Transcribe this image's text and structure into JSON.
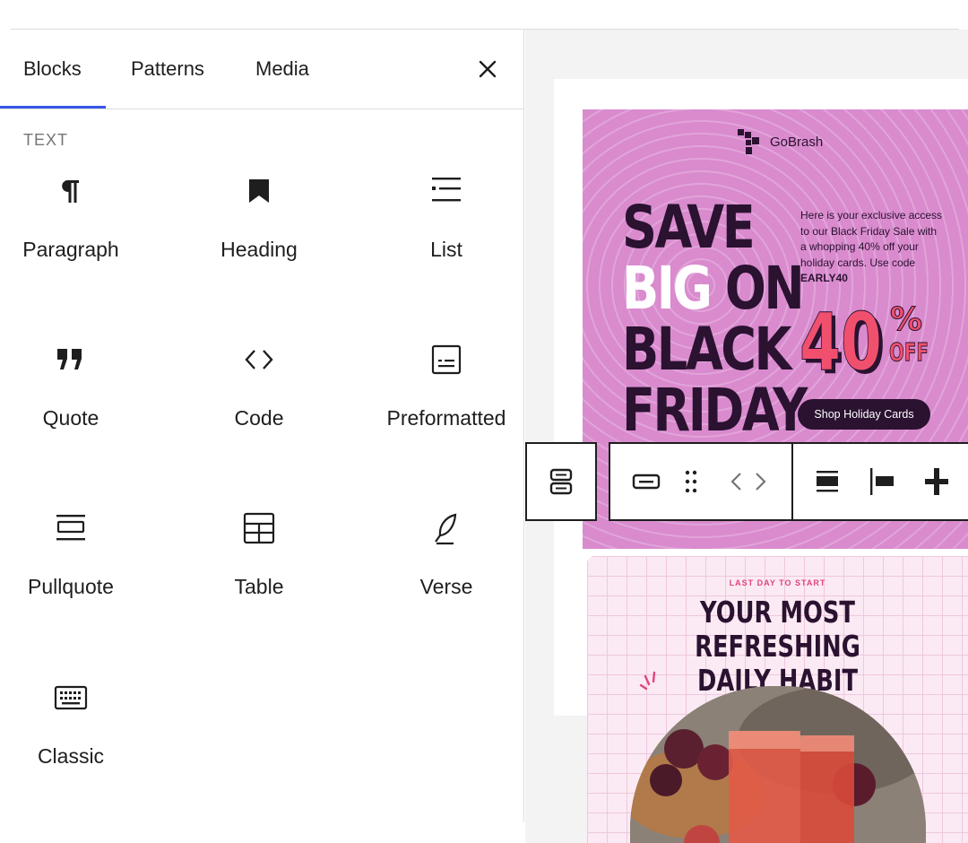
{
  "inserter": {
    "tabs": [
      "Blocks",
      "Patterns",
      "Media"
    ],
    "active_tab": "Blocks",
    "close_icon": "close-icon",
    "category": "TEXT",
    "blocks": [
      {
        "label": "Paragraph",
        "icon": "paragraph-icon"
      },
      {
        "label": "Heading",
        "icon": "heading-icon"
      },
      {
        "label": "List",
        "icon": "list-icon"
      },
      {
        "label": "Quote",
        "icon": "quote-icon"
      },
      {
        "label": "Code",
        "icon": "code-icon"
      },
      {
        "label": "Preformatted",
        "icon": "preformatted-icon"
      },
      {
        "label": "Pullquote",
        "icon": "pullquote-icon"
      },
      {
        "label": "Table",
        "icon": "table-icon"
      },
      {
        "label": "Verse",
        "icon": "verse-icon"
      },
      {
        "label": "Classic",
        "icon": "classic-icon"
      }
    ]
  },
  "canvas": {
    "card1": {
      "brand": "GoBrash",
      "headline": [
        "SAVE",
        "BIG",
        "ON",
        "BLACK",
        "FRIDAY"
      ],
      "copy": "Here is your exclusive access to our Black Friday Sale with a whopping 40% off your holiday cards. Use code",
      "code": "EARLY40",
      "percent": "40",
      "percent_sign": "%",
      "off": "OFF",
      "button": "Shop Holiday Cards"
    },
    "card2": {
      "eyebrow": "LAST DAY TO START",
      "headline_line1": "YOUR MOST REFRESHING",
      "headline_line2": "DAILY HABIT"
    }
  },
  "toolbar": {
    "buttons": [
      "parent-block-icon",
      "block-type-icon",
      "drag-handle-icon",
      "move-left-icon",
      "move-right-icon",
      "align-wide-icon",
      "align-left-icon",
      "add-icon"
    ]
  },
  "colors": {
    "accent": "#3858e9",
    "card1_bg": "#d98bce",
    "dark_purple": "#2a1230",
    "pink": "#f0506e",
    "card2_bg": "#fbeaf3"
  }
}
